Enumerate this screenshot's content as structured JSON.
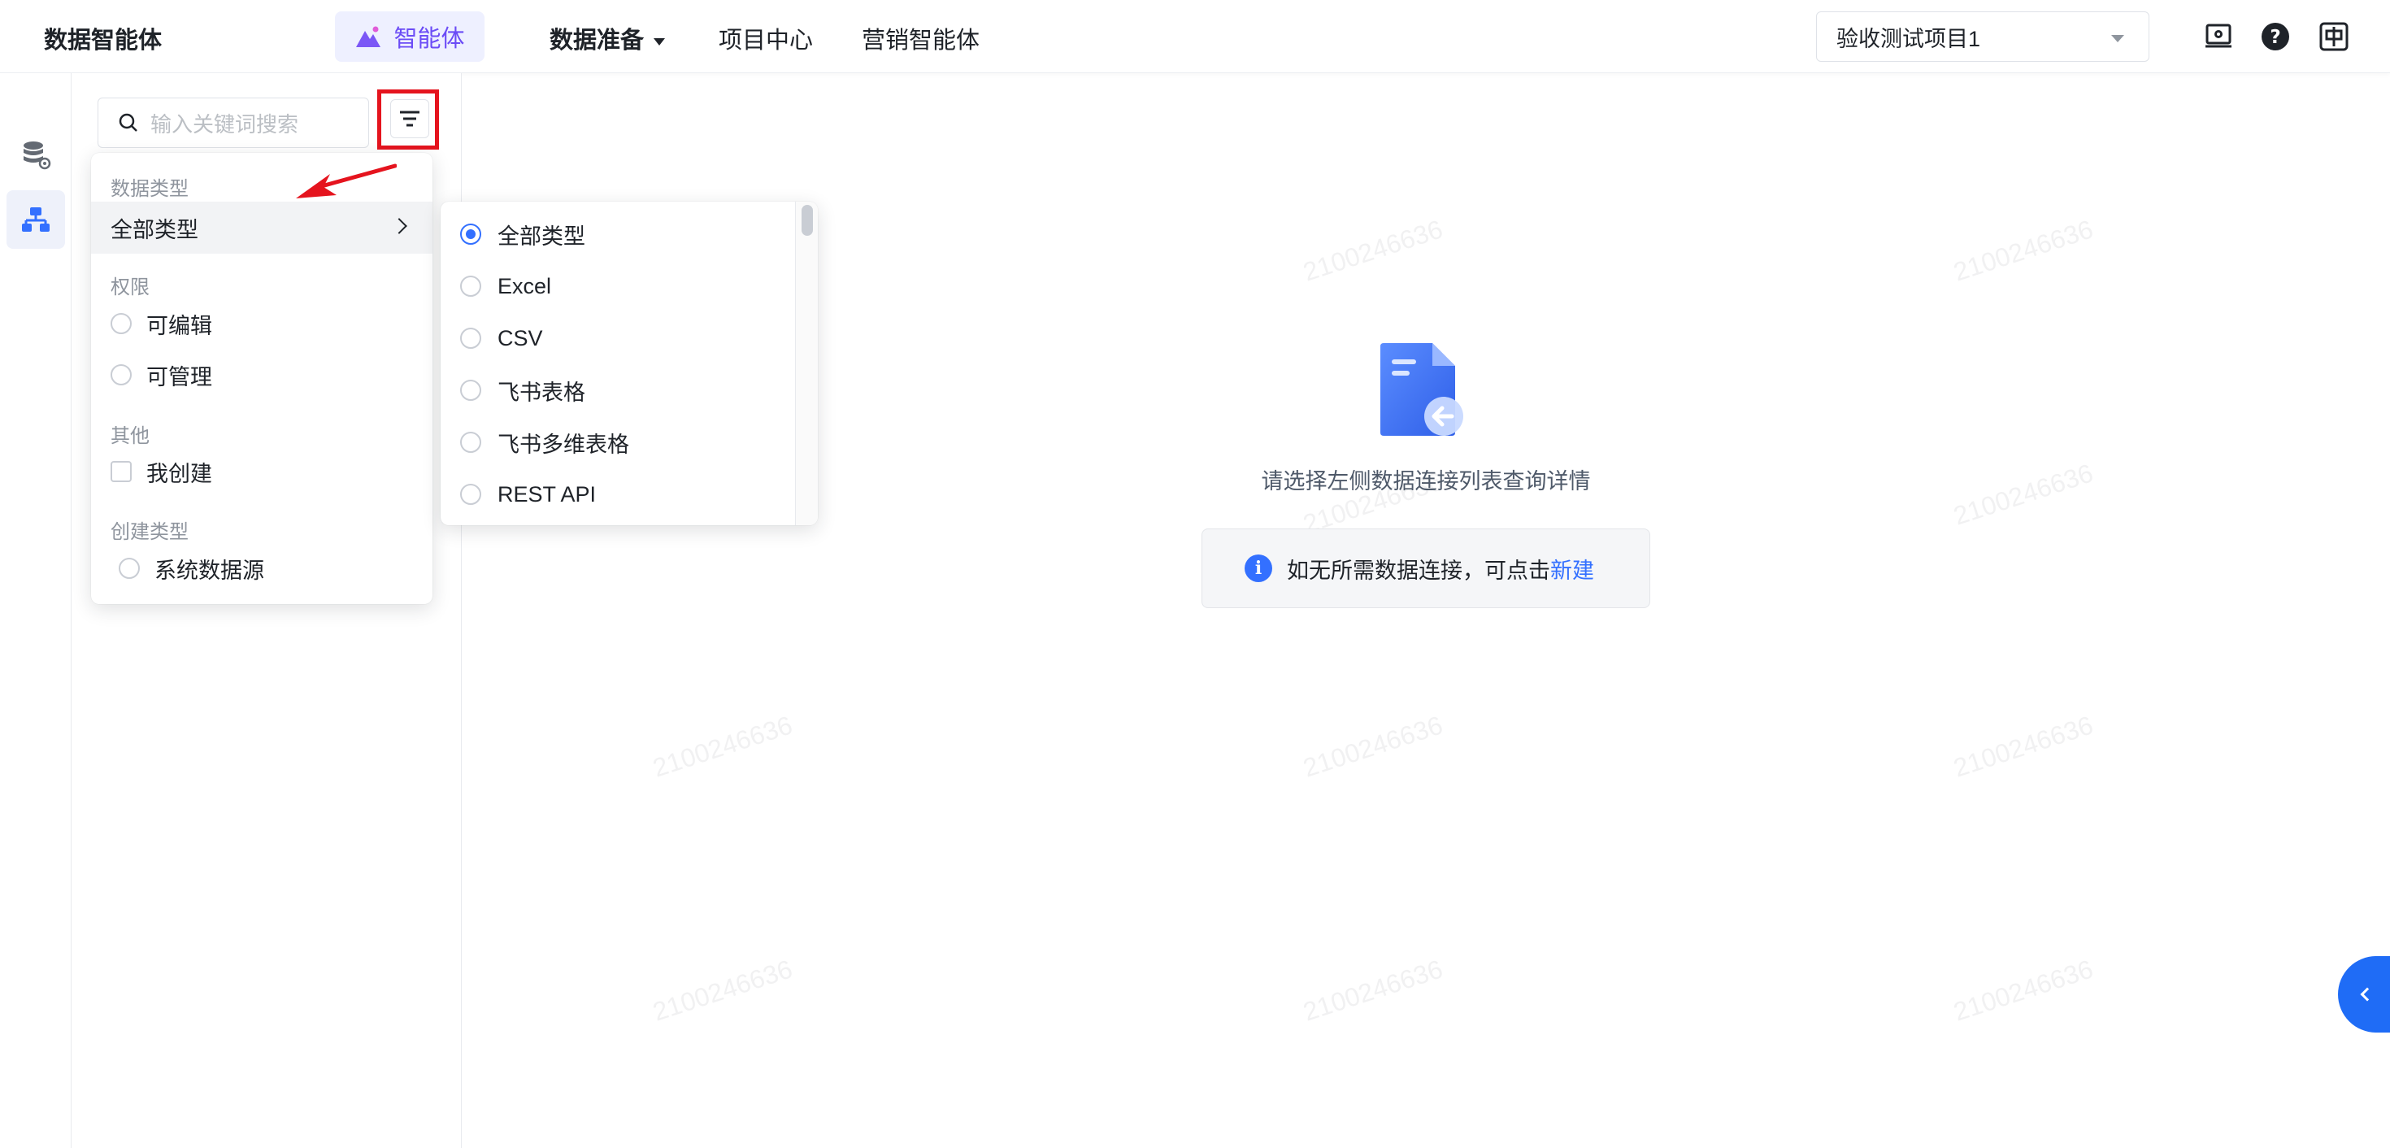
{
  "app": {
    "brand": "数据智能体"
  },
  "nav": {
    "agent_label": "智能体",
    "data_prep_label": "数据准备",
    "project_center_label": "项目中心",
    "marketing_agent_label": "营销智能体"
  },
  "project_select": {
    "value": "验收测试项目1"
  },
  "search": {
    "placeholder": "输入关键词搜索"
  },
  "filter": {
    "data_type_title": "数据类型",
    "data_type_selected": "全部类型",
    "permission_title": "权限",
    "permission_options": [
      "可编辑",
      "可管理"
    ],
    "other_title": "其他",
    "other_options": [
      "我创建"
    ],
    "create_type_title": "创建类型",
    "create_type_options": [
      "系统数据源"
    ]
  },
  "type_submenu": {
    "options": [
      "全部类型",
      "Excel",
      "CSV",
      "飞书表格",
      "飞书多维表格",
      "REST API"
    ],
    "selected": "全部类型"
  },
  "empty_state": {
    "text": "请选择左侧数据连接列表查询详情",
    "tip_prefix": "如无所需数据连接，可点击",
    "tip_link": "新建"
  },
  "watermark": "2100246636",
  "colors": {
    "accent": "#3370ff",
    "agent_purple": "#6b4cf6",
    "highlight_red": "#e5141e",
    "collapse_blue": "#1f6cf6"
  }
}
